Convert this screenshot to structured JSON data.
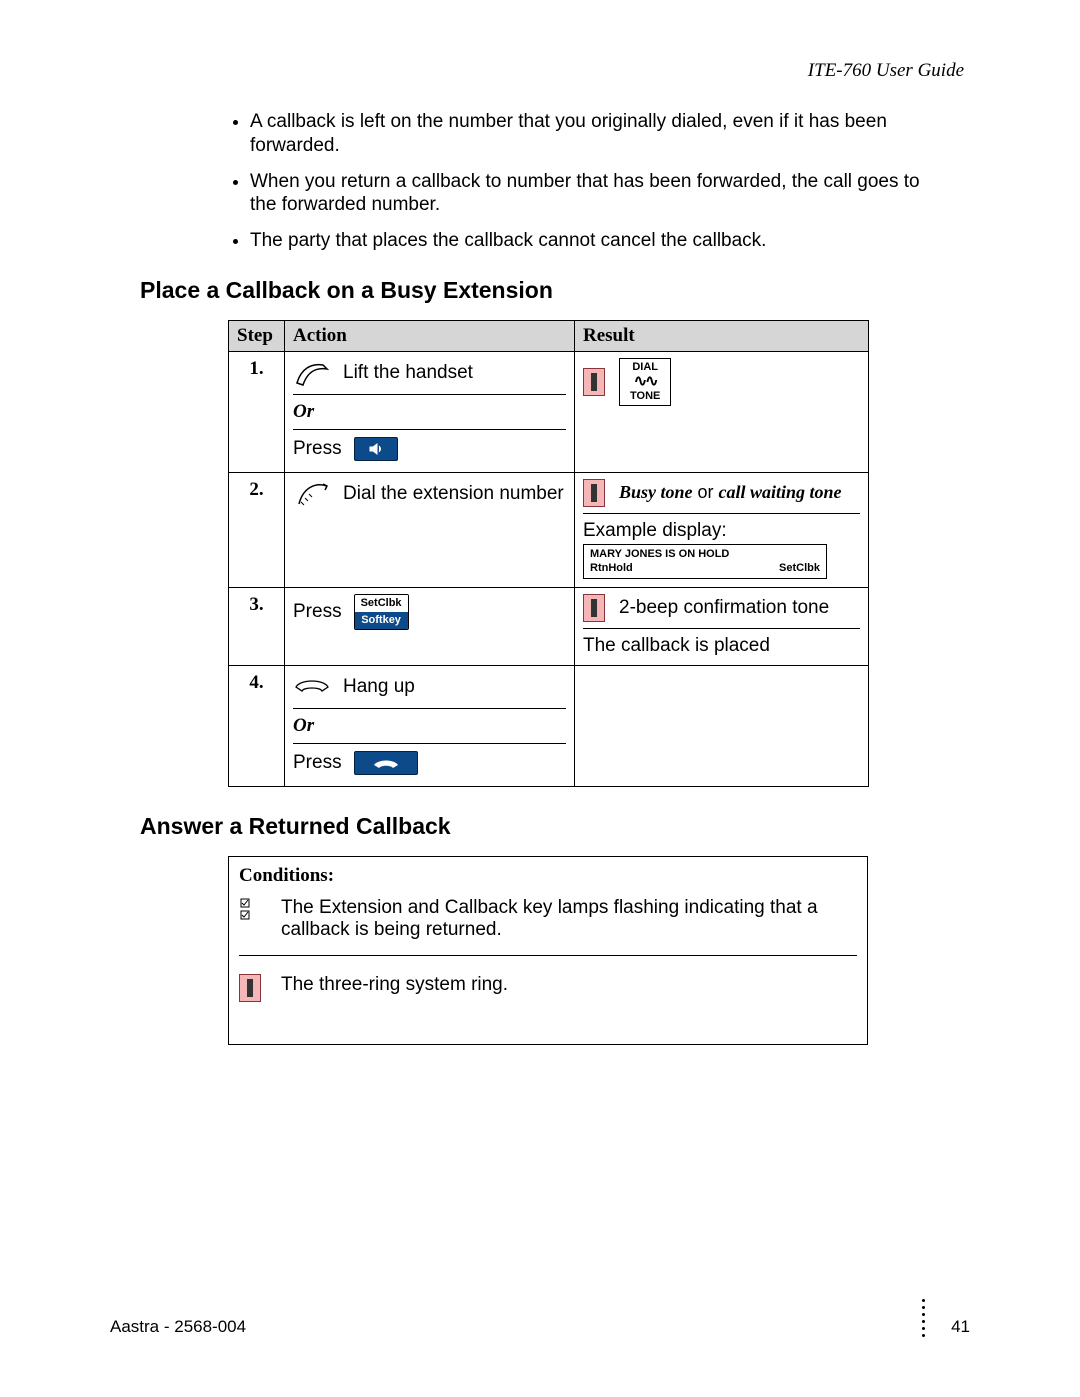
{
  "header": {
    "doc_title": "ITE-760 User Guide"
  },
  "bullets": [
    "A callback is left on the number that you originally dialed, even if it has been forwarded.",
    "When you return a callback to number that has been forwarded, the call goes to the forwarded number.",
    "The party that places the callback cannot cancel the callback."
  ],
  "heading1": "Place a Callback on a Busy Extension",
  "table": {
    "headers": {
      "step": "Step",
      "action": "Action",
      "result": "Result"
    },
    "rows": [
      {
        "num": "1.",
        "action1": "Lift the handset",
        "or": "Or",
        "action2": "Press",
        "result_dial_top": "DIAL",
        "result_dial_bot": "TONE"
      },
      {
        "num": "2.",
        "action1": "Dial the extension number",
        "result_tone_a": "Busy tone",
        "result_tone_or": " or ",
        "result_tone_b": "call waiting tone",
        "example_label": "Example display:",
        "display_line1": "MARY JONES IS ON HOLD",
        "display_left": "RtnHold",
        "display_right": "SetClbk"
      },
      {
        "num": "3.",
        "action1": "Press",
        "softkey_top": "SetClbk",
        "softkey_bot": "Softkey",
        "result1": "2-beep confirmation tone",
        "result2": "The callback is placed"
      },
      {
        "num": "4.",
        "action1": "Hang up",
        "or": "Or",
        "action2": "Press"
      }
    ]
  },
  "heading2": "Answer a Returned Callback",
  "conditions": {
    "title": "Conditions:",
    "item1": "The Extension and Callback key lamps flashing indicating that a callback is being returned.",
    "item2": "The three-ring system ring."
  },
  "footer": {
    "left": "Aastra - 2568-004",
    "page": "41"
  }
}
